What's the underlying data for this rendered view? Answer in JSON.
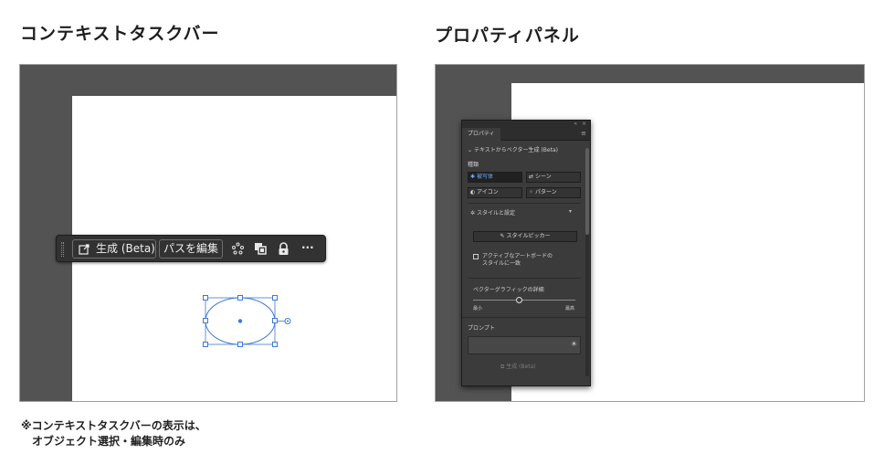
{
  "left_section": {
    "heading": "コンテキストタスクバー",
    "taskbar": {
      "generate_label": "生成 (Beta)",
      "edit_path_label": "パスを編集",
      "icons": [
        "generate-icon",
        "recolor-icon",
        "arrange-icon",
        "lock-icon",
        "more-icon"
      ],
      "more_label": "···"
    }
  },
  "right_section": {
    "heading": "プロパティパネル",
    "panel": {
      "tab_label": "プロパティ",
      "section_title": "テキストからベクター生成 (Beta)",
      "type_label": "種類",
      "type_options": [
        {
          "label": "被写体",
          "icon": "subject-icon",
          "selected": true
        },
        {
          "label": "シーン",
          "icon": "scene-icon",
          "selected": false
        },
        {
          "label": "アイコン",
          "icon": "icon-icon",
          "selected": false
        },
        {
          "label": "パターン",
          "icon": "pattern-icon",
          "selected": false
        }
      ],
      "style_settings_label": "スタイルと設定",
      "style_picker_label": "スタイルピッカー",
      "checkbox_label_line1": "アクティブなアートボードの",
      "checkbox_label_line2": "スタイルに一致",
      "detail_label": "ベクターグラフィックの詳細",
      "slider_min_label": "最小",
      "slider_max_label": "最高",
      "slider_value": 0.45,
      "prompt_label": "プロンプト",
      "generate_button_label": "生成 (Beta)"
    }
  },
  "note": {
    "line1": "※コンテキストタスクバーの表示は、",
    "line2": "オブジェクト選択・編集時のみ"
  },
  "colors": {
    "selection_blue": "#3d78d8",
    "app_gray": "#535353",
    "panel_gray": "#3b3b3b",
    "taskbar_gray": "#323232"
  }
}
